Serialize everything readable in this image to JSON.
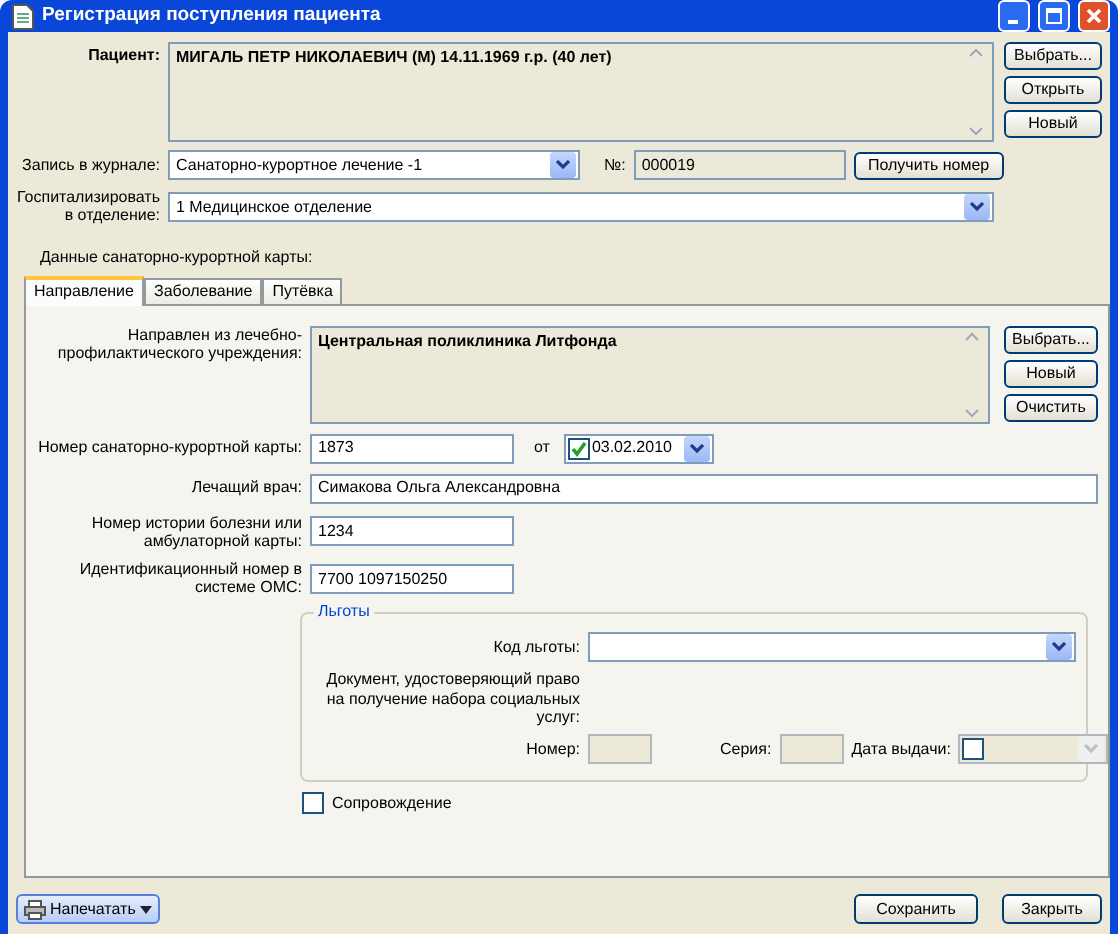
{
  "window": {
    "title": "Регистрация поступления пациента"
  },
  "patient": {
    "label": "Пациент:",
    "value": "МИГАЛЬ ПЕТР НИКОЛАЕВИЧ (М) 14.11.1969 г.р. (40 лет)",
    "buttons": [
      "Выбрать...",
      "Открыть",
      "Новый"
    ]
  },
  "journal": {
    "label": "Запись в журнале:",
    "value": "Санаторно-курортное лечение -1",
    "number_label": "№:",
    "number": "000019",
    "button": "Получить номер"
  },
  "department": {
    "label": "Госпитализировать в отделение:",
    "value": "1 Медицинское отделение"
  },
  "section_title": "Данные санаторно-курортной карты:",
  "tabs": [
    {
      "label": "Направление",
      "selected": true
    },
    {
      "label": "Заболевание",
      "selected": false
    },
    {
      "label": "Путёвка",
      "selected": false
    }
  ],
  "referral": {
    "label": "Направлен из лечебно-профилактического учреждения:",
    "value": "Центральная поликлиника Литфонда",
    "buttons": [
      "Выбрать...",
      "Новый",
      "Очистить"
    ]
  },
  "card": {
    "label": "Номер санаторно-курортной карты:",
    "value": "1873",
    "date_label": "от",
    "date_checked": true,
    "date": "03.02.2010"
  },
  "doctor": {
    "label": "Лечащий врач:",
    "value": "Симакова Ольга Александровна"
  },
  "history": {
    "label": "Номер истории болезни или амбулаторной карты:",
    "value": "1234"
  },
  "oms": {
    "label": "Идентификационный номер в системе ОМС:",
    "value": "7700 1097150250"
  },
  "benefits": {
    "title": "Льготы",
    "code_label": "Код льготы:",
    "document_label": "Документ, удостоверяющий право на получение набора социальных услуг:",
    "number_label": "Номер:",
    "series_label": "Серия:",
    "date_label": "Дата выдачи:",
    "date_checked": false,
    "disabled": true
  },
  "escort": {
    "label": "Сопровождение",
    "checked": false
  },
  "footer": {
    "print": "Напечатать",
    "save": "Сохранить",
    "close": "Закрыть"
  }
}
